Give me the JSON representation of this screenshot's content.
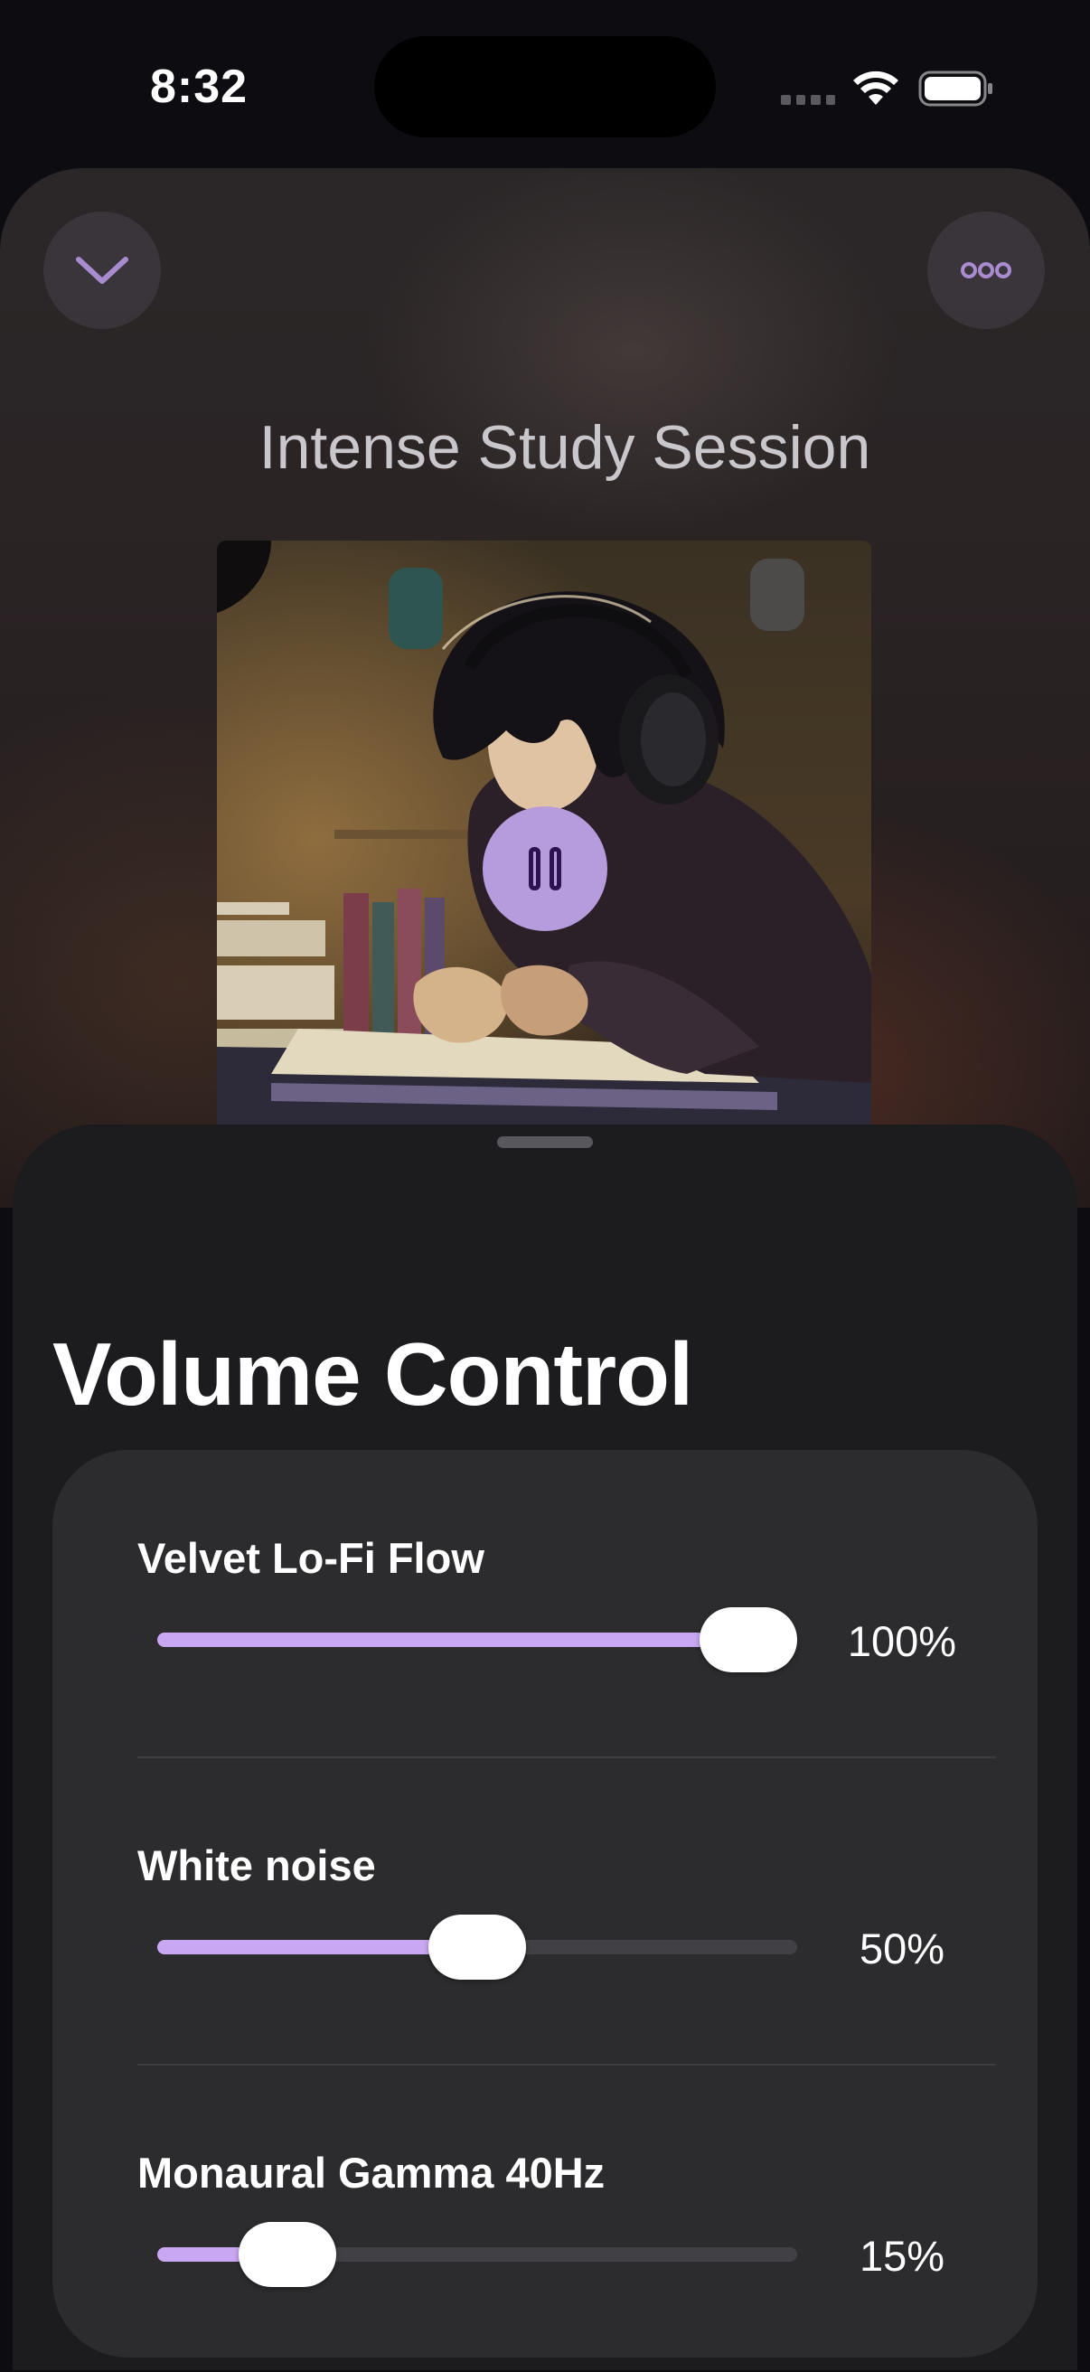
{
  "status_bar": {
    "time": "8:32"
  },
  "player": {
    "title": "Intense Study Session",
    "artwork_description": "study-girl-with-headphones-artwork",
    "is_playing": true
  },
  "sheet": {
    "title": "Volume Control",
    "tracks": [
      {
        "label": "Velvet Lo-Fi Flow",
        "value_text": "100%",
        "level": 1.0
      },
      {
        "label": "White noise",
        "value_text": "50%",
        "level": 0.5
      },
      {
        "label": "Monaural Gamma 40Hz",
        "value_text": "15%",
        "level": 0.15
      }
    ]
  },
  "colors": {
    "accent": "#c9a7f2",
    "pause_button": "#b79cdd",
    "sheet_background": "#1c1c1e",
    "panel_background": "#2c2c2e"
  },
  "icons": [
    "chevron-down-icon",
    "more-icon",
    "pause-icon",
    "wifi-icon",
    "battery-icon",
    "cellular-signal-icon"
  ]
}
